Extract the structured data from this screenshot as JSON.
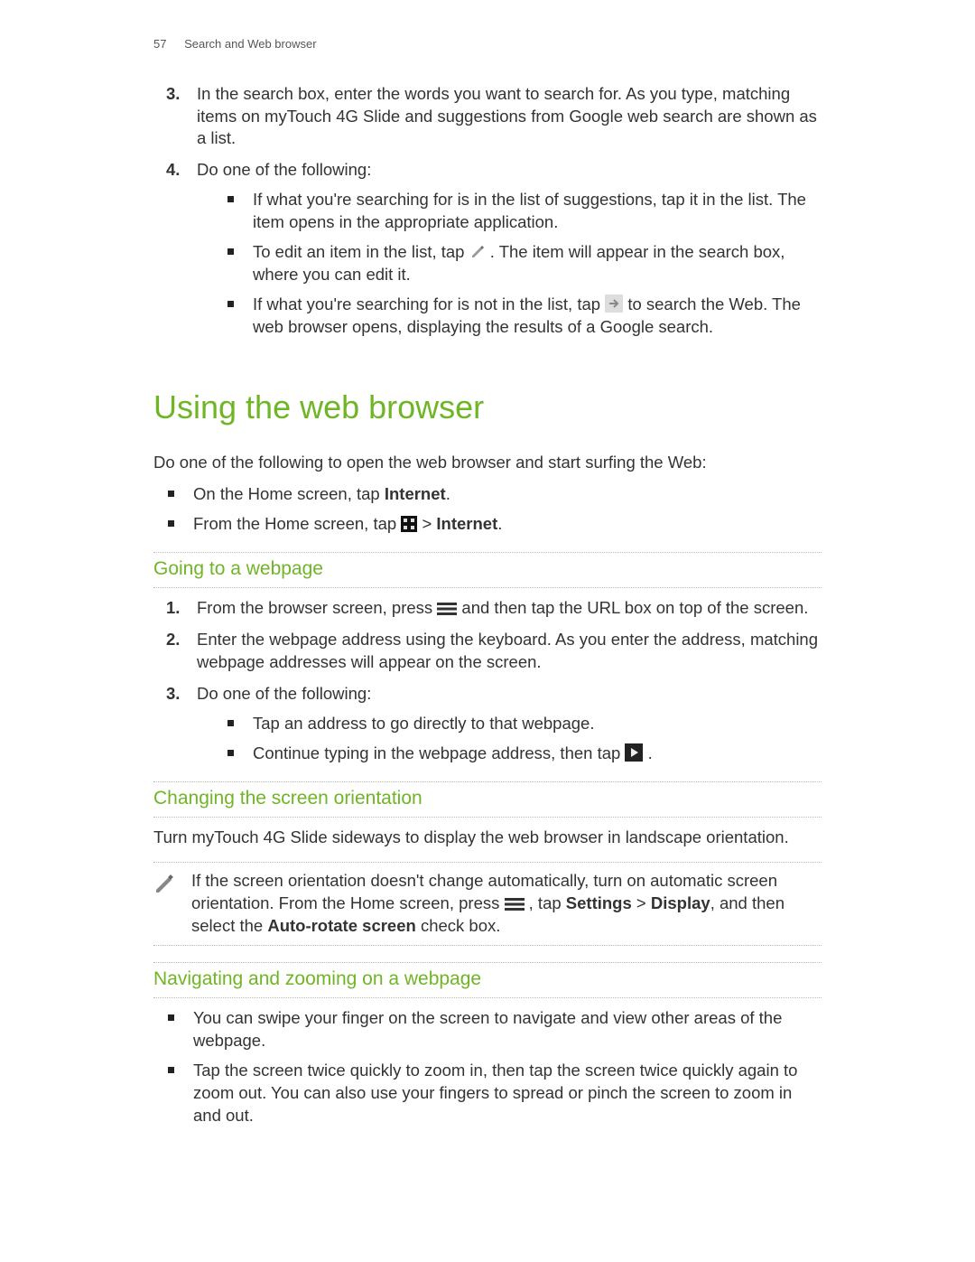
{
  "header": {
    "pageNumber": "57",
    "sectionTitle": "Search and Web browser"
  },
  "topSteps": {
    "step3": "In the search box, enter the words you want to search for. As you type, matching items on myTouch 4G Slide and suggestions from Google web search are shown as a list.",
    "step4Lead": "Do one of the following:",
    "step4Bullets": {
      "b1": "If what you're searching for is in the list of suggestions, tap it in the list. The item opens in the appropriate application.",
      "b2a": "To edit an item in the list, tap ",
      "b2b": ". The item will appear in the search box, where you can edit it.",
      "b3a": "If what you're searching for is not in the list, tap ",
      "b3b": " to search the Web. The web browser opens, displaying the results of a Google search."
    }
  },
  "mainHeading": "Using the web browser",
  "introPara": "Do one of the following to open the web browser and start surfing the Web:",
  "introBullets": {
    "a1a": "On the Home screen, tap ",
    "a1b": "Internet",
    "a1c": ".",
    "a2a": "From the Home screen, tap ",
    "a2b": " > ",
    "a2c": "Internet",
    "a2d": "."
  },
  "goingHeading": "Going to a webpage",
  "goingSteps": {
    "s1a": "From the browser screen, press ",
    "s1b": " and then tap the URL box on top of the screen.",
    "s2": "Enter the webpage address using the keyboard. As you enter the address, matching webpage addresses will appear on the screen.",
    "s3Lead": "Do one of the following:",
    "s3b1": "Tap an address to go directly to that webpage.",
    "s3b2a": "Continue typing in the webpage address, then tap ",
    "s3b2b": "."
  },
  "orientHeading": "Changing the screen orientation",
  "orientPara": "Turn myTouch 4G Slide sideways to display the web browser in landscape orientation.",
  "orientNote": {
    "p1": "If the screen orientation doesn't change automatically, turn on automatic screen orientation. From the Home screen, press ",
    "p2": ", tap ",
    "b1": "Settings",
    "sep": " > ",
    "b2": "Display",
    "p3": ", and then select the ",
    "b3": "Auto-rotate screen",
    "p4": " check box."
  },
  "navHeading": "Navigating and zooming on a webpage",
  "navBullets": {
    "n1": "You can swipe your finger on the screen to navigate and view other areas of the webpage.",
    "n2": "Tap the screen twice quickly to zoom in, then tap the screen twice quickly again to zoom out. You can also use your fingers to spread or pinch the screen to zoom in and out."
  }
}
